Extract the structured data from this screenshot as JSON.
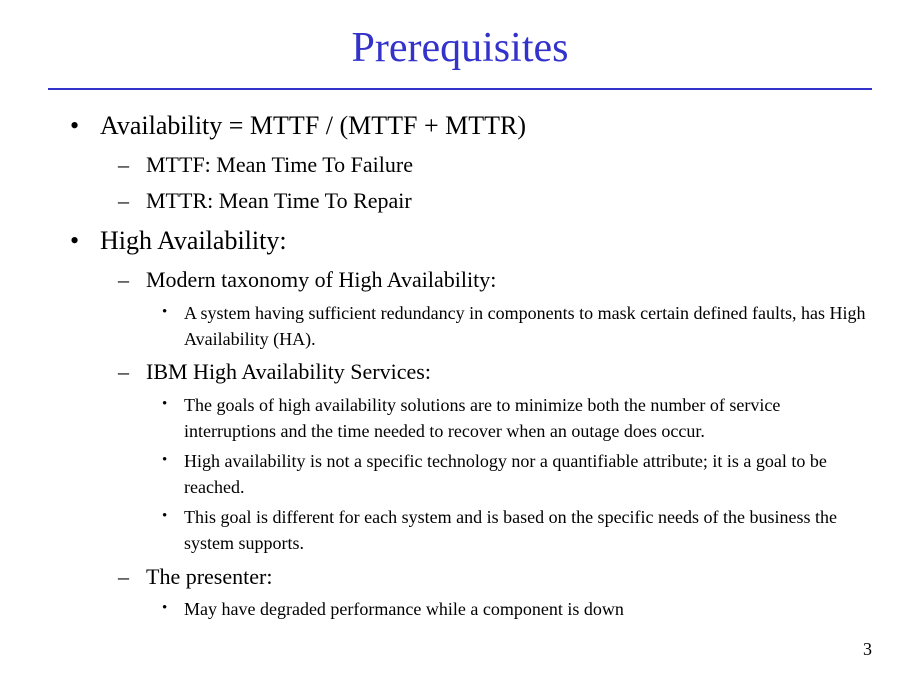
{
  "title": "Prerequisites",
  "bullets": {
    "item0": {
      "text": "Availability = MTTF / (MTTF + MTTR)",
      "sub": {
        "s0": "MTTF: Mean Time To Failure",
        "s1": "MTTR: Mean Time To Repair"
      }
    },
    "item1": {
      "text": "High Availability:",
      "sub": {
        "s0": {
          "text": "Modern taxonomy of High Availability:",
          "sub": {
            "t0": "A system having sufficient redundancy in components to mask certain defined faults, has High Availability (HA)."
          }
        },
        "s1": {
          "text": "IBM High Availability Services:",
          "sub": {
            "t0": "The goals of high availability solutions are to minimize both the number of service interruptions and the time needed to recover when an outage does occur.",
            "t1": "High availability is not a specific technology nor a quantifiable attribute; it is a goal to be reached.",
            "t2": "This goal is different for each system and is based on the specific needs of the business the system supports."
          }
        },
        "s2": {
          "text": "The presenter:",
          "sub": {
            "t0": "May have degraded performance while a component is down"
          }
        }
      }
    }
  },
  "pageNumber": "3"
}
